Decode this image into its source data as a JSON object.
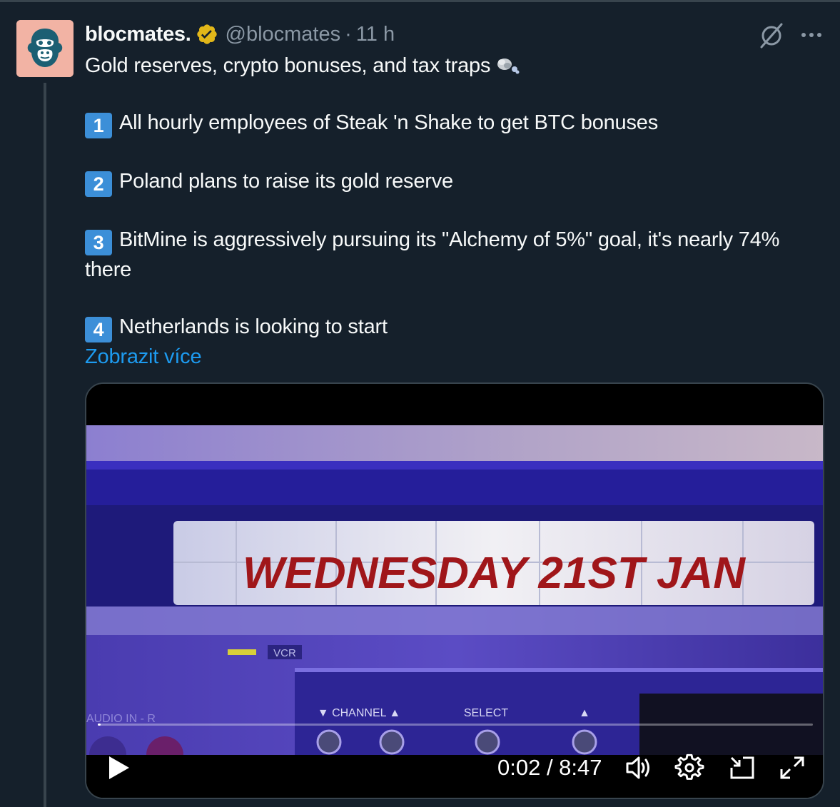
{
  "author": {
    "display_name": "blocmates.",
    "handle": "@blocmates",
    "separator": "·",
    "time": "11 h",
    "avatar_colors": {
      "bg": "#f2b3a4",
      "face": "#1c5f73"
    },
    "verified_color": "#e2b719"
  },
  "icons": {
    "verified": "verified-gold-badge-icon",
    "grok": "grok-slash-icon",
    "more": "more-horizontal-icon",
    "emoji": "brain-emoji-icon",
    "play": "play-icon",
    "volume": "volume-icon",
    "settings": "settings-gear-icon",
    "pip": "picture-in-picture-icon",
    "fullscreen": "fullscreen-icon"
  },
  "tweet": {
    "intro": "Gold reserves, crypto bonuses, and tax traps",
    "items": [
      {
        "num": "1",
        "text": "All hourly employees of Steak 'n Shake to get BTC bonuses"
      },
      {
        "num": "2",
        "text": "Poland plans to raise its gold reserve"
      },
      {
        "num": "3",
        "text": "BitMine is aggressively pursuing its \"Alchemy of 5%\" goal, it's nearly 74% there"
      },
      {
        "num": "4",
        "text": "Netherlands is looking to start"
      }
    ],
    "show_more": "Zobrazit více"
  },
  "video": {
    "frame_text": "WEDNESDAY 21ST JAN",
    "device_labels": {
      "vcr": "VCR",
      "audio": "AUDIO IN - R",
      "channel": "▼ CHANNEL ▲",
      "select": "SELECT",
      "eject": "▲"
    },
    "current_time": "0:02",
    "duration": "8:47",
    "time_display": "0:02 / 8:47",
    "progress_fraction": 0.004
  },
  "colors": {
    "background": "#15202b",
    "text": "#f7f9f9",
    "muted": "#8b98a5",
    "link": "#1d9bf0",
    "keycap": "#3c8fd8",
    "border": "#38444d"
  }
}
